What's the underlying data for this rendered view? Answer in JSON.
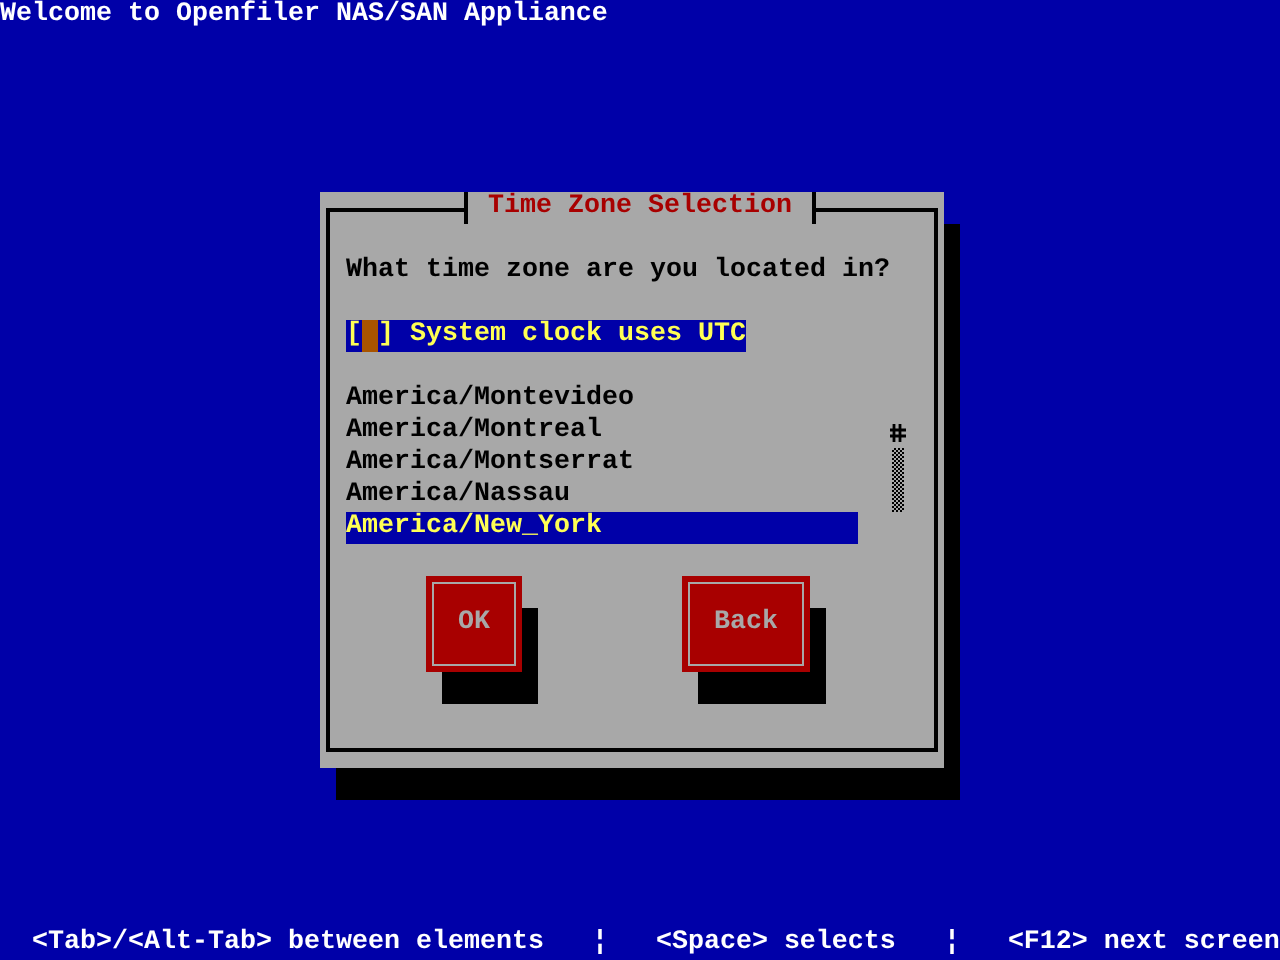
{
  "header": {
    "title": "Welcome to Openfiler NAS/SAN Appliance"
  },
  "dialog": {
    "title": "Time Zone Selection",
    "prompt": "What time zone are you located in?",
    "checkbox": {
      "open": "[",
      "close": "]",
      "label": "System clock uses UTC",
      "checked": false,
      "focused": true
    },
    "timezones": [
      {
        "label": "America/Montevideo",
        "selected": false
      },
      {
        "label": "America/Montreal",
        "selected": false
      },
      {
        "label": "America/Montserrat",
        "selected": false
      },
      {
        "label": "America/Nassau",
        "selected": false
      },
      {
        "label": "America/New_York",
        "selected": true
      }
    ],
    "buttons": [
      "OK",
      "Back"
    ]
  },
  "status_bar": [
    "<Tab>/<Alt-Tab> between elements",
    "¦",
    "<Space> selects",
    "¦",
    "<F12> next screen"
  ]
}
